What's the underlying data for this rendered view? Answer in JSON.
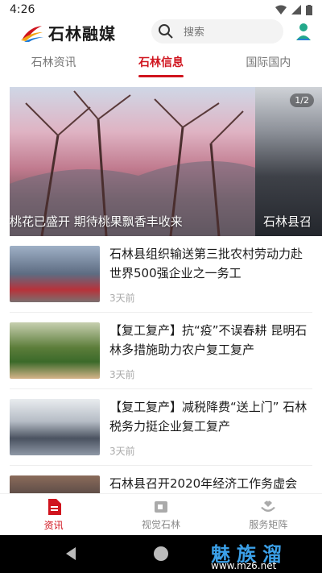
{
  "status": {
    "time": "4:26"
  },
  "header": {
    "logo_text": "石林融媒",
    "search_placeholder": "搜索"
  },
  "tabs": [
    {
      "label": "石林资讯"
    },
    {
      "label": "石林信息"
    },
    {
      "label": "国际国内"
    }
  ],
  "carousel": {
    "pager": "1/2",
    "slides": [
      {
        "caption": "桃花已盛开 期待桃果飘香丰收来"
      },
      {
        "caption": "石林县召"
      }
    ]
  },
  "news": [
    {
      "title": "石林县组织输送第三批农村劳动力赴世界500强企业之一务工",
      "time": "3天前"
    },
    {
      "title": "【复工复产】抗“疫”不误春耕 昆明石林多措施助力农户复工复产",
      "time": "3天前"
    },
    {
      "title": "【复工复产】减税降费“送上门” 石林税务力挺企业复工复产",
      "time": "3天前"
    },
    {
      "title": "石林县召开2020年经济工作务虚会",
      "time": ""
    }
  ],
  "bottom_nav": [
    {
      "label": "资讯"
    },
    {
      "label": "视觉石林"
    },
    {
      "label": "服务矩阵"
    }
  ],
  "watermark": {
    "text": "魅族溜",
    "url": "www.mz6.net"
  },
  "colors": {
    "accent": "#d0141e",
    "watermark": "#3ba0e8"
  }
}
